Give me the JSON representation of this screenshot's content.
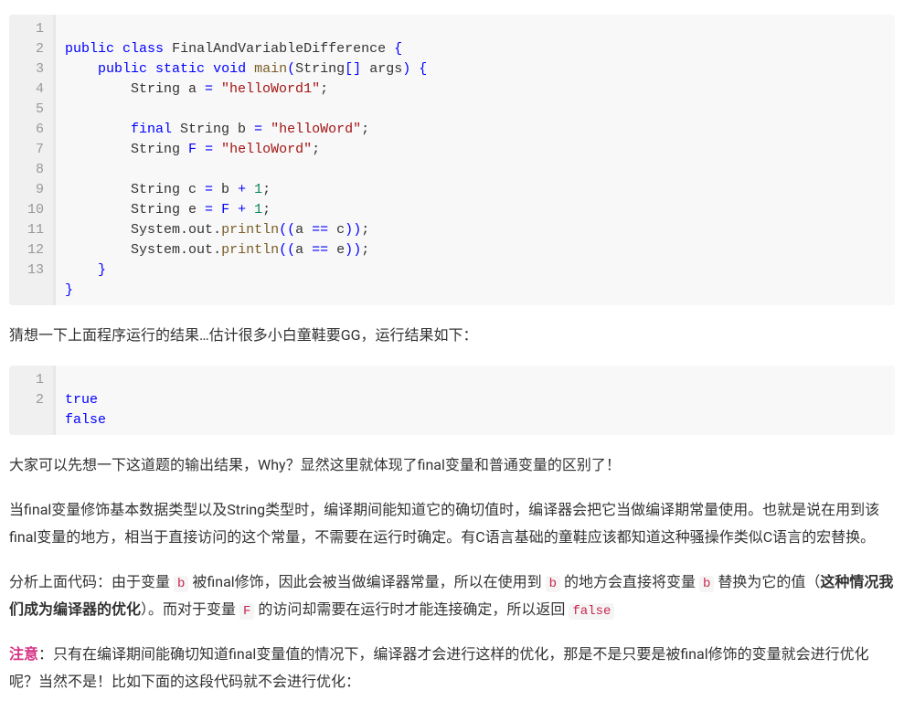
{
  "code1": {
    "lines": [
      "1",
      "2",
      "3",
      "4",
      "5",
      "6",
      "7",
      "8",
      "9",
      "10",
      "11",
      "12",
      "13"
    ],
    "l1": {
      "public": "public",
      "class": "class",
      "name": "FinalAndVariableDifference",
      "ob": "{"
    },
    "l2": {
      "indent": "    ",
      "public": "public",
      "static": "static",
      "void": "void",
      "main": "main",
      "lp": "(",
      "type": "String",
      "lb": "[",
      "rb": "]",
      "arg": " args",
      "rp": ")",
      "ob": "{"
    },
    "l3": {
      "indent": "        ",
      "type": "String a ",
      "eq": "=",
      "str": " \"helloWord1\"",
      "semi": ";"
    },
    "l5": {
      "indent": "        ",
      "final": "final",
      "type": " String b ",
      "eq": "=",
      "str": " \"helloWord\"",
      "semi": ";"
    },
    "l6": {
      "indent": "        ",
      "type": "String ",
      "F": "F",
      "sp": " ",
      "eq": "=",
      "str": " \"helloWord\"",
      "semi": ";"
    },
    "l8": {
      "indent": "        ",
      "type": "String c ",
      "eq": "=",
      "b": " b ",
      "plus": "+",
      "sp": " ",
      "one": "1",
      "semi": ";"
    },
    "l9": {
      "indent": "        ",
      "type": "String e ",
      "eq": "=",
      "sp": " ",
      "F": "F",
      "sp2": " ",
      "plus": "+",
      "sp3": " ",
      "one": "1",
      "semi": ";"
    },
    "l10": {
      "indent": "        ",
      "sys": "System",
      "dot1": ".",
      "out": "out",
      "dot2": ".",
      "println": "println",
      "lp1": "(",
      "lp2": "(",
      "a": "a ",
      "eqeq": "==",
      "c": " c",
      "rp1": ")",
      "rp2": ")",
      "semi": ";"
    },
    "l11": {
      "indent": "        ",
      "sys": "System",
      "dot1": ".",
      "out": "out",
      "dot2": ".",
      "println": "println",
      "lp1": "(",
      "lp2": "(",
      "a": "a ",
      "eqeq": "==",
      "e": " e",
      "rp1": ")",
      "rp2": ")",
      "semi": ";"
    },
    "l12": {
      "indent": "    ",
      "cb": "}"
    },
    "l13": {
      "cb": "}"
    }
  },
  "para1": "猜想一下上面程序运行的结果…估计很多小白童鞋要GG，运行结果如下：",
  "code2": {
    "lines": [
      "1",
      "2"
    ],
    "true": "true",
    "false": "false"
  },
  "para2": "大家可以先想一下这道题的输出结果，Why？显然这里就体现了final变量和普通变量的区别了！",
  "para3": "当final变量修饰基本数据类型以及String类型时，编译期间能知道它的确切值时，编译器会把它当做编译期常量使用。也就是说在用到该final变量的地方，相当于直接访问的这个常量，不需要在运行时确定。有C语言基础的童鞋应该都知道这种骚操作类似C语言的宏替换。",
  "para4": {
    "t1": "分析上面代码：由于变量 ",
    "b1": "b",
    "t2": " 被final修饰，因此会被当做编译器常量，所以在使用到 ",
    "b2": "b",
    "t3": " 的地方会直接将变量 ",
    "b3": "b",
    "t4": " 替换为它的值（",
    "bold": "这种情况我们成为编译器的优化",
    "t5": "）。而对于变量 ",
    "f": "F",
    "t6": " 的访问却需要在运行时才能连接确定，所以返回 ",
    "false": "false"
  },
  "para5": {
    "label": "注意",
    "t1": "：只有在编译期间能确切知道final变量值的情况下，编译器才会进行这样的优化，那是不是只要是被final修饰的变量就会进行优化呢？当然不是！比如下面的这段代码就不会进行优化："
  }
}
